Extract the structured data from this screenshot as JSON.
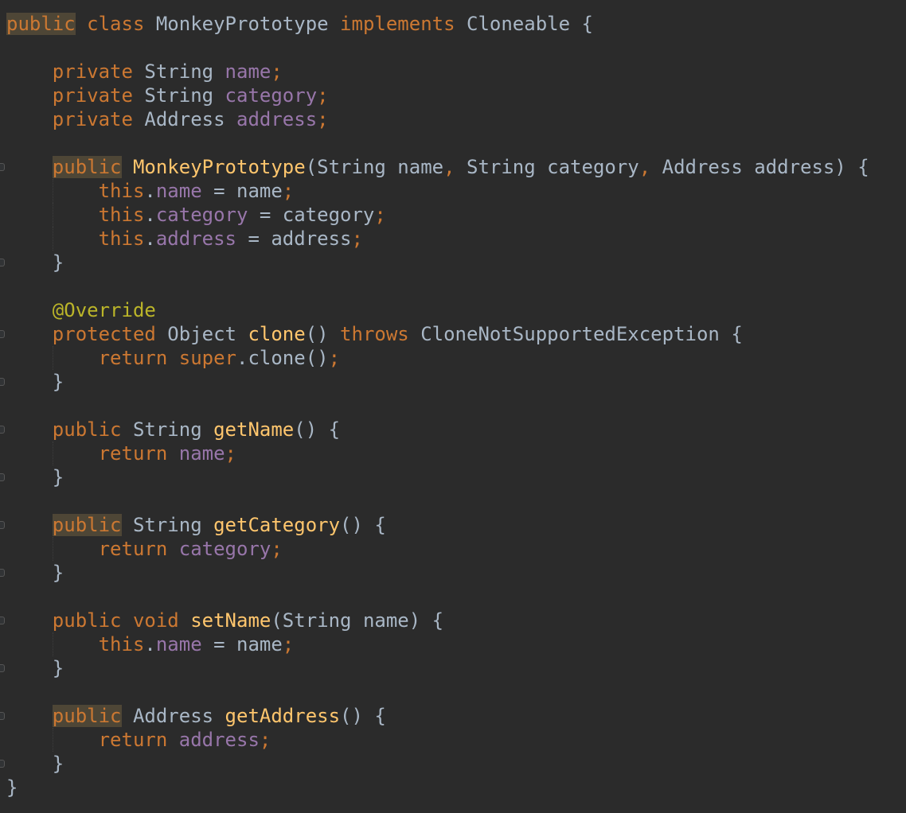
{
  "colors": {
    "background": "#2b2b2b",
    "keyword": "#cc7832",
    "plain": "#a9b7c6",
    "field": "#9876aa",
    "method": "#ffc66d",
    "annotation": "#bbb529",
    "highlight": "#4e4636"
  },
  "fold_marker_icon": "fold-marker-icon",
  "lines": [
    {
      "folds": false,
      "tokens": [
        {
          "text": "public",
          "type": "kw",
          "hl": true
        },
        {
          "text": " ",
          "type": "plain"
        },
        {
          "text": "class",
          "type": "kw"
        },
        {
          "text": " MonkeyPrototype ",
          "type": "plain"
        },
        {
          "text": "implements",
          "type": "kw"
        },
        {
          "text": " Cloneable {",
          "type": "plain"
        }
      ]
    },
    {
      "folds": false,
      "tokens": []
    },
    {
      "folds": false,
      "tokens": [
        {
          "text": "    ",
          "type": "plain"
        },
        {
          "text": "private",
          "type": "kw"
        },
        {
          "text": " String ",
          "type": "plain"
        },
        {
          "text": "name",
          "type": "field"
        },
        {
          "text": ";",
          "type": "kw"
        }
      ]
    },
    {
      "folds": false,
      "tokens": [
        {
          "text": "    ",
          "type": "plain"
        },
        {
          "text": "private",
          "type": "kw"
        },
        {
          "text": " String ",
          "type": "plain"
        },
        {
          "text": "category",
          "type": "field"
        },
        {
          "text": ";",
          "type": "kw"
        }
      ]
    },
    {
      "folds": false,
      "tokens": [
        {
          "text": "    ",
          "type": "plain"
        },
        {
          "text": "private",
          "type": "kw"
        },
        {
          "text": " Address ",
          "type": "plain"
        },
        {
          "text": "address",
          "type": "field"
        },
        {
          "text": ";",
          "type": "kw"
        }
      ]
    },
    {
      "folds": false,
      "tokens": []
    },
    {
      "folds": true,
      "tokens": [
        {
          "text": "    ",
          "type": "plain"
        },
        {
          "text": "public",
          "type": "kw",
          "hl": true
        },
        {
          "text": " ",
          "type": "plain"
        },
        {
          "text": "MonkeyPrototype",
          "type": "method"
        },
        {
          "text": "(String name",
          "type": "plain"
        },
        {
          "text": ",",
          "type": "kw"
        },
        {
          "text": " String category",
          "type": "plain"
        },
        {
          "text": ",",
          "type": "kw"
        },
        {
          "text": " Address address) {",
          "type": "plain"
        }
      ]
    },
    {
      "folds": false,
      "guide": true,
      "tokens": [
        {
          "text": "        ",
          "type": "plain"
        },
        {
          "text": "this",
          "type": "kw"
        },
        {
          "text": ".",
          "type": "plain"
        },
        {
          "text": "name",
          "type": "field"
        },
        {
          "text": " = name",
          "type": "plain"
        },
        {
          "text": ";",
          "type": "kw"
        }
      ]
    },
    {
      "folds": false,
      "guide": true,
      "tokens": [
        {
          "text": "        ",
          "type": "plain"
        },
        {
          "text": "this",
          "type": "kw"
        },
        {
          "text": ".",
          "type": "plain"
        },
        {
          "text": "category",
          "type": "field"
        },
        {
          "text": " = category",
          "type": "plain"
        },
        {
          "text": ";",
          "type": "kw"
        }
      ]
    },
    {
      "folds": false,
      "guide": true,
      "tokens": [
        {
          "text": "        ",
          "type": "plain"
        },
        {
          "text": "this",
          "type": "kw"
        },
        {
          "text": ".",
          "type": "plain"
        },
        {
          "text": "address",
          "type": "field"
        },
        {
          "text": " = address",
          "type": "plain"
        },
        {
          "text": ";",
          "type": "kw"
        }
      ]
    },
    {
      "folds": true,
      "tokens": [
        {
          "text": "    }",
          "type": "plain"
        }
      ]
    },
    {
      "folds": false,
      "tokens": []
    },
    {
      "folds": false,
      "tokens": [
        {
          "text": "    ",
          "type": "plain"
        },
        {
          "text": "@Override",
          "type": "ann"
        }
      ]
    },
    {
      "folds": true,
      "tokens": [
        {
          "text": "    ",
          "type": "plain"
        },
        {
          "text": "protected",
          "type": "kw"
        },
        {
          "text": " Object ",
          "type": "plain"
        },
        {
          "text": "clone",
          "type": "method"
        },
        {
          "text": "() ",
          "type": "plain"
        },
        {
          "text": "throws",
          "type": "kw"
        },
        {
          "text": " CloneNotSupportedException {",
          "type": "plain"
        }
      ]
    },
    {
      "folds": false,
      "guide": true,
      "tokens": [
        {
          "text": "        ",
          "type": "plain"
        },
        {
          "text": "return",
          "type": "kw"
        },
        {
          "text": " ",
          "type": "plain"
        },
        {
          "text": "super",
          "type": "kw"
        },
        {
          "text": ".clone()",
          "type": "plain"
        },
        {
          "text": ";",
          "type": "kw"
        }
      ]
    },
    {
      "folds": true,
      "tokens": [
        {
          "text": "    }",
          "type": "plain"
        }
      ]
    },
    {
      "folds": false,
      "tokens": []
    },
    {
      "folds": true,
      "tokens": [
        {
          "text": "    ",
          "type": "plain"
        },
        {
          "text": "public",
          "type": "kw"
        },
        {
          "text": " String ",
          "type": "plain"
        },
        {
          "text": "getName",
          "type": "method"
        },
        {
          "text": "() {",
          "type": "plain"
        }
      ]
    },
    {
      "folds": false,
      "guide": true,
      "tokens": [
        {
          "text": "        ",
          "type": "plain"
        },
        {
          "text": "return",
          "type": "kw"
        },
        {
          "text": " ",
          "type": "plain"
        },
        {
          "text": "name",
          "type": "field"
        },
        {
          "text": ";",
          "type": "kw"
        }
      ]
    },
    {
      "folds": true,
      "tokens": [
        {
          "text": "    }",
          "type": "plain"
        }
      ]
    },
    {
      "folds": false,
      "tokens": []
    },
    {
      "folds": true,
      "tokens": [
        {
          "text": "    ",
          "type": "plain"
        },
        {
          "text": "public",
          "type": "kw",
          "hl": true
        },
        {
          "text": " String ",
          "type": "plain"
        },
        {
          "text": "getCategory",
          "type": "method"
        },
        {
          "text": "() {",
          "type": "plain"
        }
      ]
    },
    {
      "folds": false,
      "guide": true,
      "tokens": [
        {
          "text": "        ",
          "type": "plain"
        },
        {
          "text": "return",
          "type": "kw"
        },
        {
          "text": " ",
          "type": "plain"
        },
        {
          "text": "category",
          "type": "field"
        },
        {
          "text": ";",
          "type": "kw"
        }
      ]
    },
    {
      "folds": true,
      "tokens": [
        {
          "text": "    }",
          "type": "plain"
        }
      ]
    },
    {
      "folds": false,
      "tokens": []
    },
    {
      "folds": true,
      "tokens": [
        {
          "text": "    ",
          "type": "plain"
        },
        {
          "text": "public",
          "type": "kw"
        },
        {
          "text": " ",
          "type": "plain"
        },
        {
          "text": "void",
          "type": "kw"
        },
        {
          "text": " ",
          "type": "plain"
        },
        {
          "text": "setName",
          "type": "method"
        },
        {
          "text": "(String name) {",
          "type": "plain"
        }
      ]
    },
    {
      "folds": false,
      "guide": true,
      "tokens": [
        {
          "text": "        ",
          "type": "plain"
        },
        {
          "text": "this",
          "type": "kw"
        },
        {
          "text": ".",
          "type": "plain"
        },
        {
          "text": "name",
          "type": "field"
        },
        {
          "text": " = name",
          "type": "plain"
        },
        {
          "text": ";",
          "type": "kw"
        }
      ]
    },
    {
      "folds": true,
      "tokens": [
        {
          "text": "    }",
          "type": "plain"
        }
      ]
    },
    {
      "folds": false,
      "tokens": []
    },
    {
      "folds": true,
      "tokens": [
        {
          "text": "    ",
          "type": "plain"
        },
        {
          "text": "public",
          "type": "kw",
          "hl": true
        },
        {
          "text": " Address ",
          "type": "plain"
        },
        {
          "text": "getAddress",
          "type": "method"
        },
        {
          "text": "() {",
          "type": "plain"
        }
      ]
    },
    {
      "folds": false,
      "guide": true,
      "tokens": [
        {
          "text": "        ",
          "type": "plain"
        },
        {
          "text": "return",
          "type": "kw"
        },
        {
          "text": " ",
          "type": "plain"
        },
        {
          "text": "address",
          "type": "field"
        },
        {
          "text": ";",
          "type": "kw"
        }
      ]
    },
    {
      "folds": true,
      "tokens": [
        {
          "text": "    }",
          "type": "plain"
        }
      ]
    },
    {
      "folds": false,
      "tokens": [
        {
          "text": "}",
          "type": "plain"
        }
      ]
    }
  ]
}
